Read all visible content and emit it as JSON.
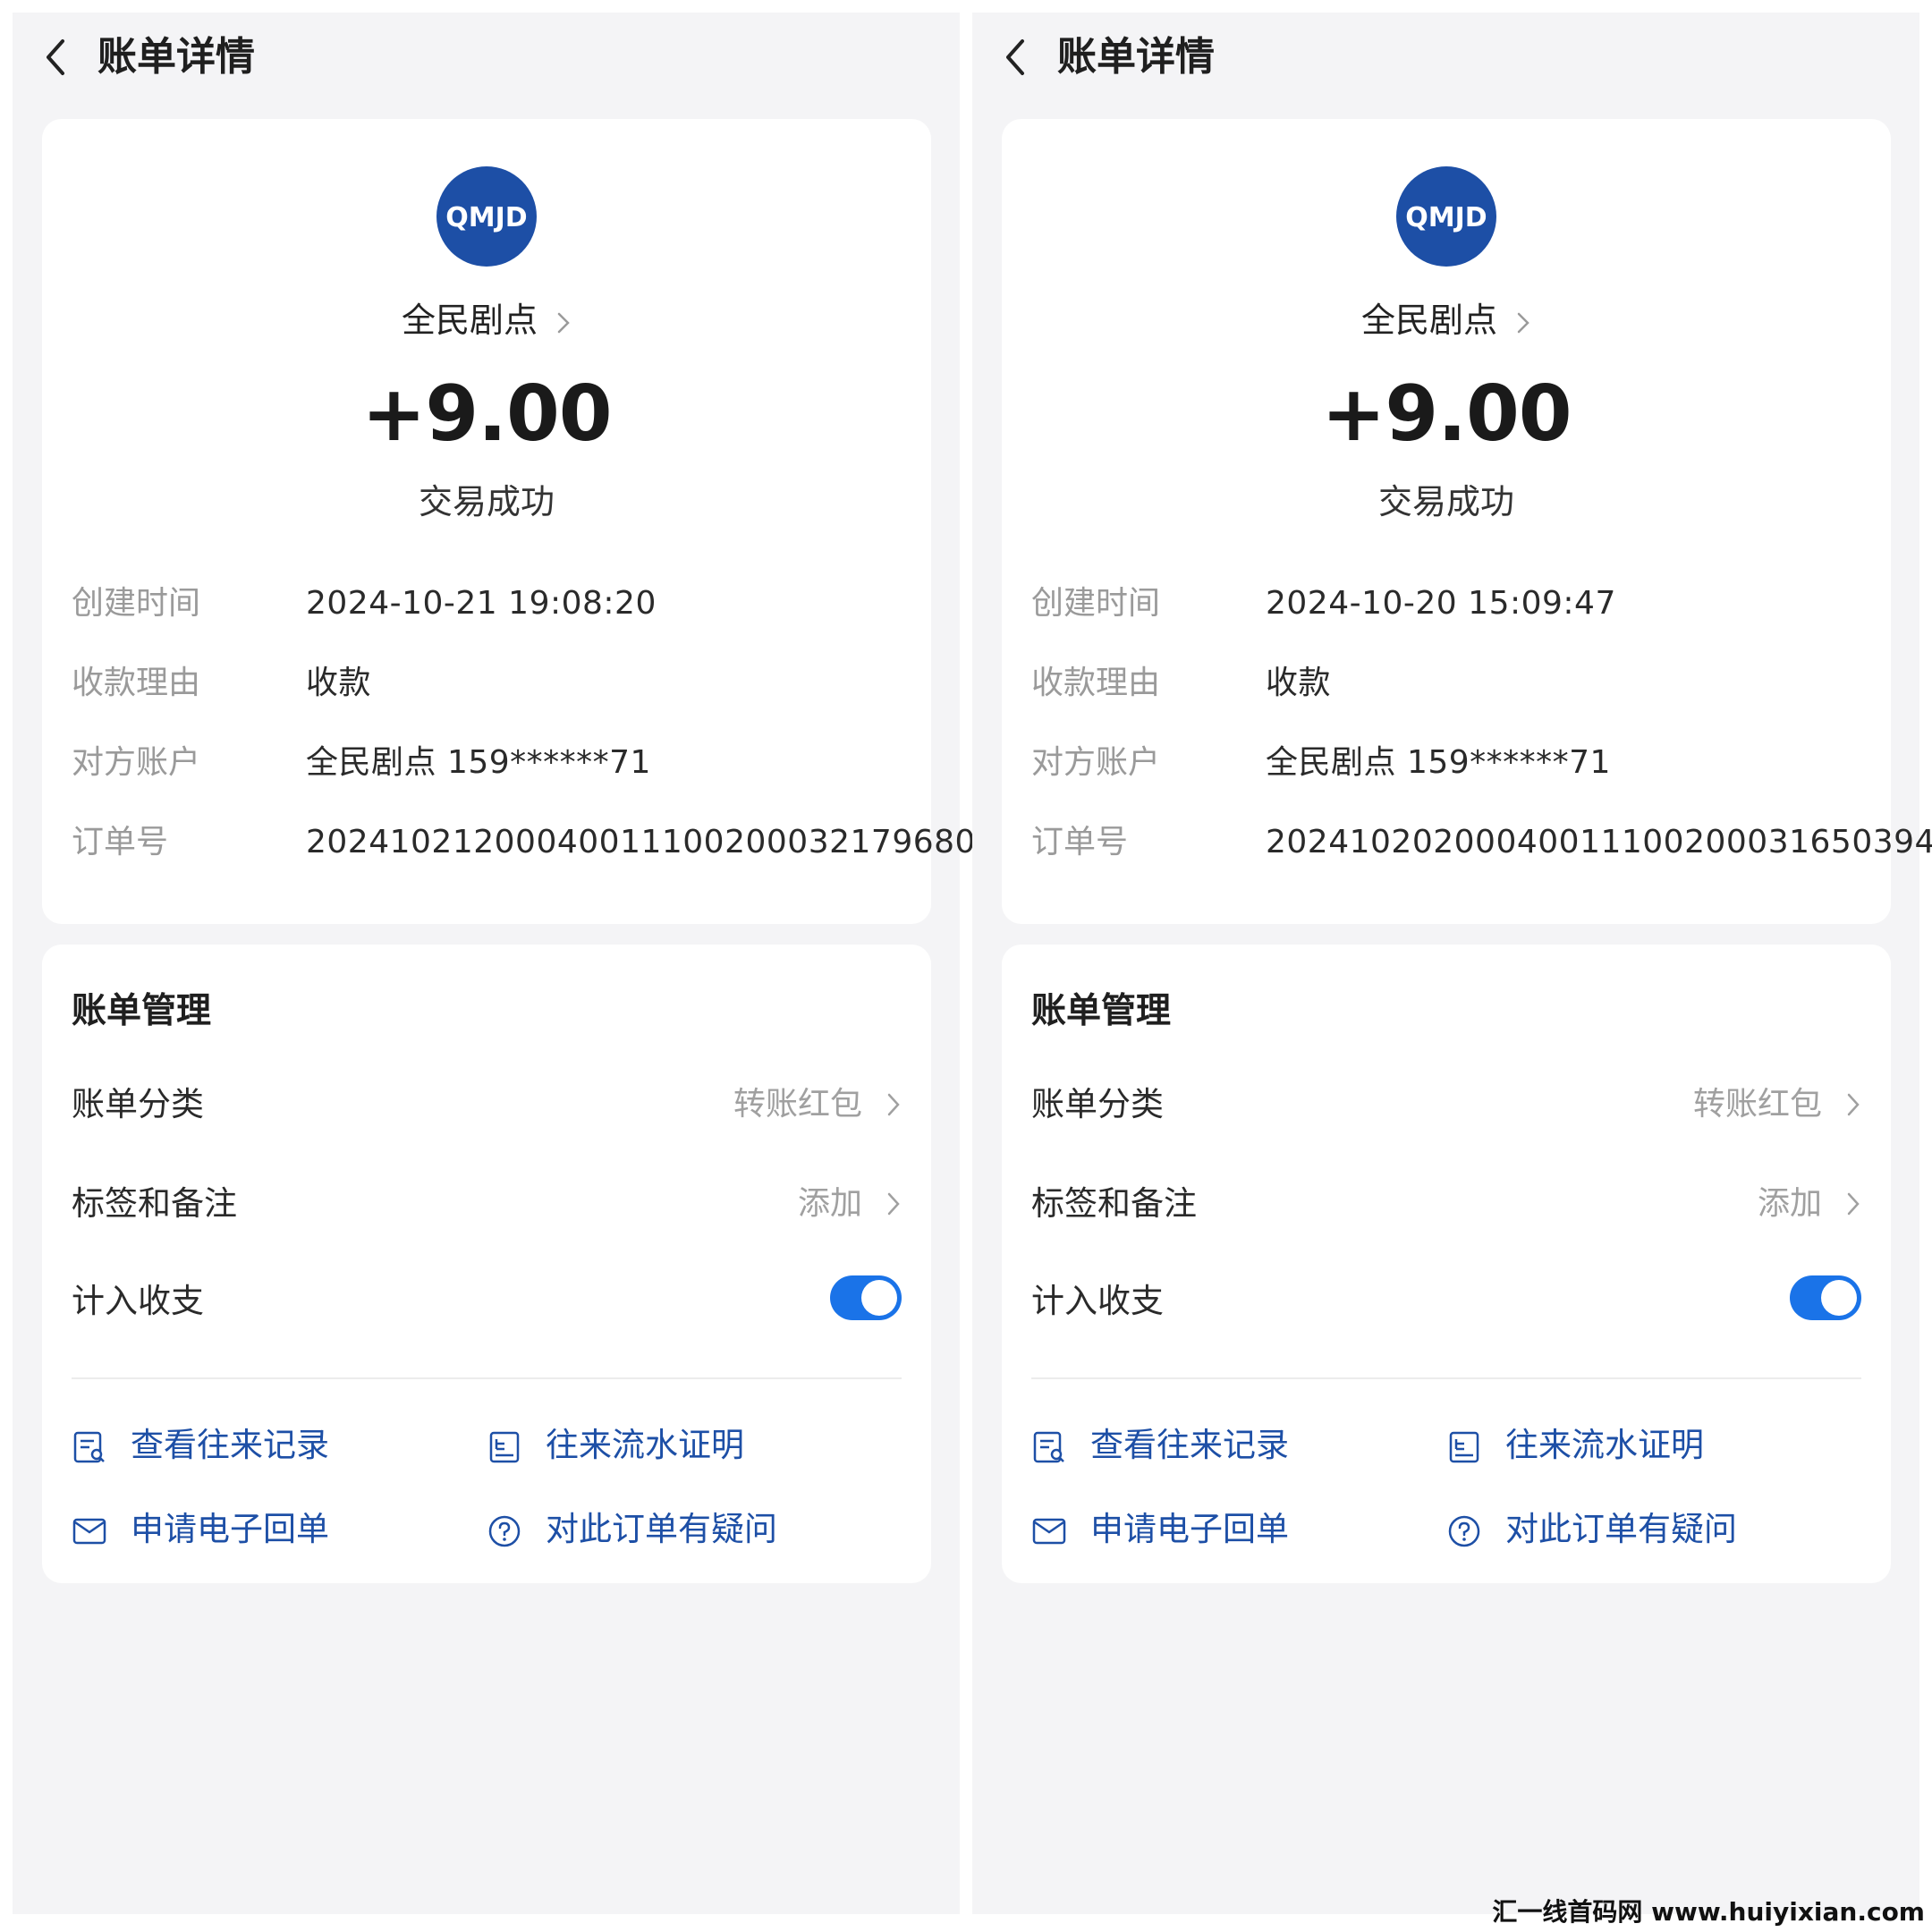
{
  "screens": [
    {
      "header": {
        "title": "账单详情"
      },
      "merchant": {
        "logo_text": "QMJD",
        "name": "全民剧点"
      },
      "amount": "+9.00",
      "status": "交易成功",
      "details": [
        {
          "label": "创建时间",
          "value": "2024-10-21 19:08:20"
        },
        {
          "label": "收款理由",
          "value": "收款"
        },
        {
          "label": "对方账户",
          "value": "全民剧点 159******71"
        },
        {
          "label": "订单号",
          "value": "20241021200040011100200032179680"
        }
      ],
      "manage": {
        "title": "账单管理",
        "category": {
          "label": "账单分类",
          "value": "转账红包"
        },
        "tags": {
          "label": "标签和备注",
          "value": "添加"
        },
        "income": {
          "label": "计入收支",
          "enabled": true
        }
      },
      "actions": {
        "records": "查看往来记录",
        "proof": "往来流水证明",
        "receipt": "申请电子回单",
        "question": "对此订单有疑问"
      }
    },
    {
      "header": {
        "title": "账单详情"
      },
      "merchant": {
        "logo_text": "QMJD",
        "name": "全民剧点"
      },
      "amount": "+9.00",
      "status": "交易成功",
      "details": [
        {
          "label": "创建时间",
          "value": "2024-10-20 15:09:47"
        },
        {
          "label": "收款理由",
          "value": "收款"
        },
        {
          "label": "对方账户",
          "value": "全民剧点 159******71"
        },
        {
          "label": "订单号",
          "value": "20241020200040011100200031650394"
        }
      ],
      "manage": {
        "title": "账单管理",
        "category": {
          "label": "账单分类",
          "value": "转账红包"
        },
        "tags": {
          "label": "标签和备注",
          "value": "添加"
        },
        "income": {
          "label": "计入收支",
          "enabled": true
        }
      },
      "actions": {
        "records": "查看往来记录",
        "proof": "往来流水证明",
        "receipt": "申请电子回单",
        "question": "对此订单有疑问"
      }
    }
  ],
  "watermark": "汇一线首码网 www.huiyixian.com",
  "colors": {
    "accent": "#1d4fa6",
    "toggle": "#1a73e8",
    "background": "#f4f4f6",
    "card": "#ffffff"
  }
}
